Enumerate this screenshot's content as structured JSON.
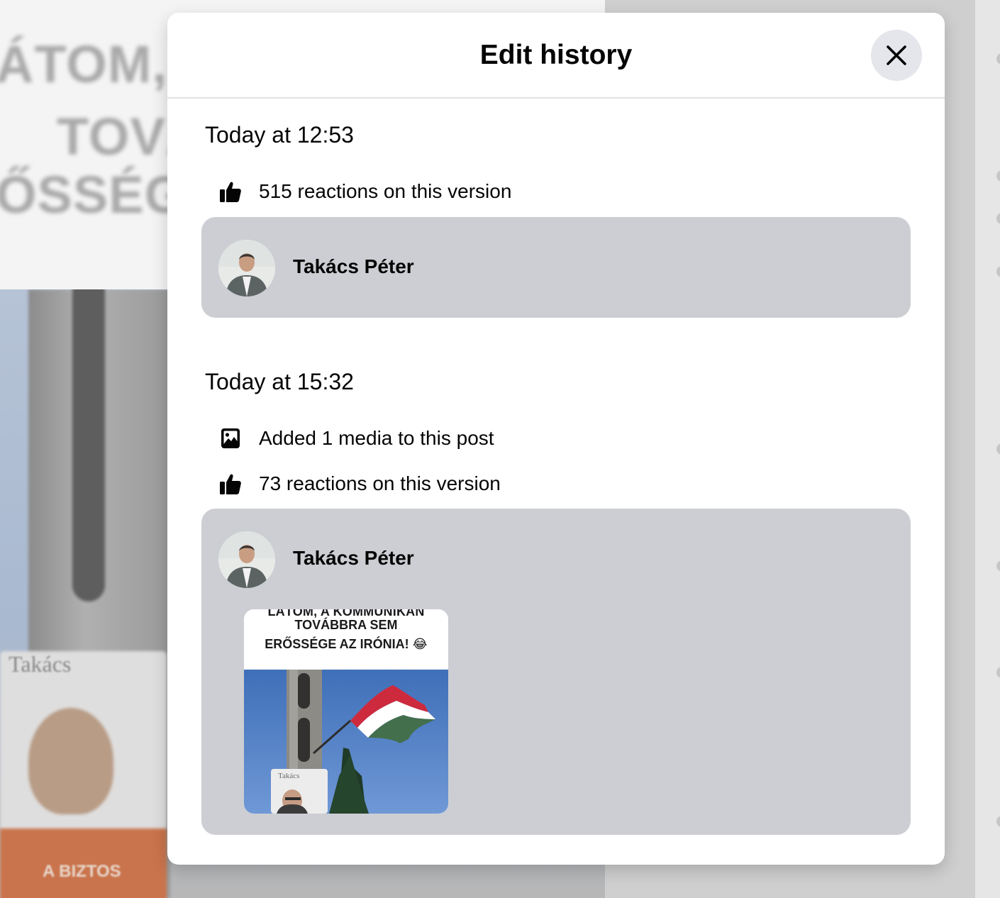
{
  "background": {
    "headline_lines": [
      "ÁTOM, A",
      "TOVÁ",
      "ŐSSÉGE"
    ],
    "poster_name": "Takács",
    "poster_slogan": "A BIZTOS"
  },
  "modal": {
    "title": "Edit history",
    "close_icon": "close-icon",
    "versions": [
      {
        "time": "Today at 12:53",
        "reactions": "515 reactions on this version",
        "author": "Takács Péter"
      },
      {
        "time": "Today at 15:32",
        "media_change": "Added 1 media to this post",
        "reactions": "73 reactions on this version",
        "author": "Takács Péter",
        "media": {
          "cut_line": "LÁTOM, A KOMMUNIKÁN",
          "line2": "TOVÁBBRA SEM",
          "line3": "ERŐSSÉGE AZ IRÓNIA! 😂",
          "poster_text": "Takács"
        }
      }
    ]
  },
  "colors": {
    "card_bg": "#ccced3",
    "close_bg": "#e4e6eb",
    "flag_red": "#cd2a3e",
    "flag_white": "#ffffff",
    "flag_green": "#436f4d"
  }
}
